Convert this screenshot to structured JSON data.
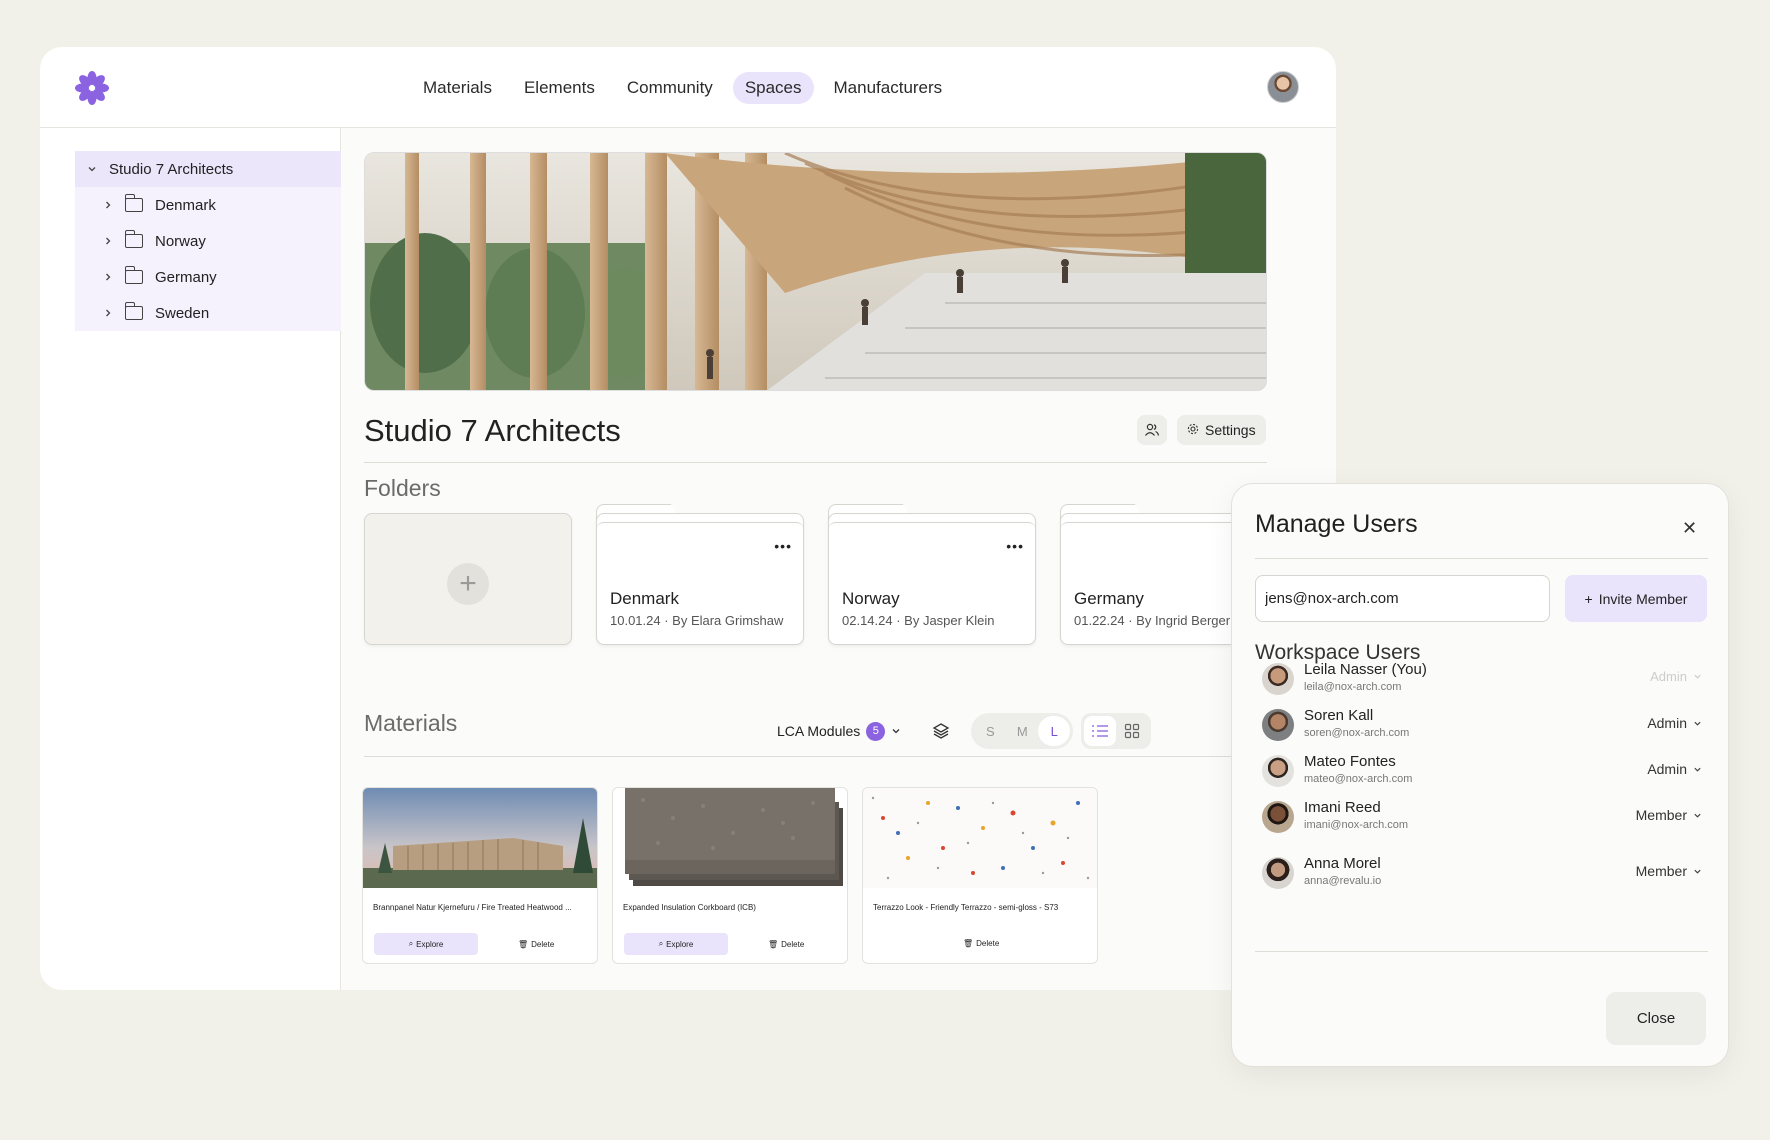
{
  "nav": {
    "items": [
      {
        "label": "Materials",
        "active": false
      },
      {
        "label": "Elements",
        "active": false
      },
      {
        "label": "Community",
        "active": false
      },
      {
        "label": "Spaces",
        "active": true
      },
      {
        "label": "Manufacturers",
        "active": false
      }
    ]
  },
  "sidebar": {
    "root": "Studio 7 Architects",
    "children": [
      "Denmark",
      "Norway",
      "Germany",
      "Sweden"
    ]
  },
  "space": {
    "title": "Studio 7 Architects",
    "settings_label": "Settings"
  },
  "folders": {
    "heading": "Folders",
    "items": [
      {
        "name": "Denmark",
        "meta": "10.01.24 · By Elara Grimshaw"
      },
      {
        "name": "Norway",
        "meta": "02.14.24 · By Jasper Klein"
      },
      {
        "name": "Germany",
        "meta": "01.22.24 · By Ingrid Berger"
      }
    ]
  },
  "materials": {
    "heading": "Materials",
    "lca_label": "LCA Modules",
    "lca_count": "5",
    "sizes": [
      "S",
      "M",
      "L"
    ],
    "selected_size": "L",
    "cards": [
      {
        "title": "Brannpanel Natur Kjernefuru / Fire Treated Heatwood ...",
        "explore": "Explore",
        "delete": "Delete"
      },
      {
        "title": "Expanded Insulation Corkboard (ICB)",
        "explore": "Explore",
        "delete": "Delete"
      },
      {
        "title": "Terrazzo Look - Friendly Terrazzo - semi-gloss - S73",
        "delete": "Delete"
      }
    ]
  },
  "modal": {
    "title": "Manage Users",
    "email_value": "jens@nox-arch.com",
    "invite_label": "Invite Member",
    "workspace_title": "Workspace Users",
    "users": [
      {
        "name": "Leila Nasser (You)",
        "email": "leila@nox-arch.com",
        "role": "Admin"
      },
      {
        "name": "Soren Kall",
        "email": "soren@nox-arch.com",
        "role": "Admin"
      },
      {
        "name": "Mateo Fontes",
        "email": "mateo@nox-arch.com",
        "role": "Admin"
      },
      {
        "name": "Imani Reed",
        "email": "imani@nox-arch.com",
        "role": "Member"
      },
      {
        "name": "Anna Morel",
        "email": "anna@revalu.io",
        "role": "Member"
      }
    ],
    "close_label": "Close"
  },
  "colors": {
    "accent": "#8b62e0",
    "accent_soft": "#e9e3fb",
    "background": "#f1f0e9"
  }
}
